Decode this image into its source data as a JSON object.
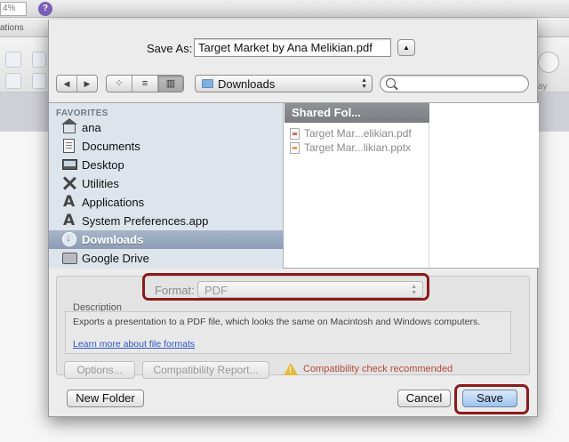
{
  "background_app": {
    "zoom_value": "4%",
    "help_symbol": "?",
    "tab_label": "ations",
    "right_label": "ay"
  },
  "dialog": {
    "save_as_label": "Save As:",
    "filename": "Target Market by Ana Melikian.pdf",
    "expand_symbol": "▲",
    "nav": {
      "back_symbol": "◀",
      "forward_symbol": "▶"
    },
    "view_modes": [
      "⁘",
      "≡",
      "▥"
    ],
    "location": "Downloads",
    "search_placeholder": "",
    "sidebar": {
      "header": "FAVORITES",
      "items": [
        {
          "label": "ana",
          "icon": "home-icon"
        },
        {
          "label": "Documents",
          "icon": "documents-icon"
        },
        {
          "label": "Desktop",
          "icon": "desktop-icon"
        },
        {
          "label": "Utilities",
          "icon": "utilities-icon"
        },
        {
          "label": "Applications",
          "icon": "applications-icon"
        },
        {
          "label": "System Preferences.app",
          "icon": "system-preferences-icon"
        },
        {
          "label": "Downloads",
          "icon": "downloads-icon",
          "selected": true
        },
        {
          "label": "Google Drive",
          "icon": "folder-icon"
        }
      ]
    },
    "column1": {
      "header": "Shared Fol...",
      "files": [
        {
          "name": "Target Mar...elikian.pdf",
          "icon": "pdf-file-icon"
        },
        {
          "name": "Target Mar...likian.pptx",
          "icon": "pptx-file-icon"
        }
      ]
    },
    "options": {
      "format_label": "Format:",
      "format_value": "PDF",
      "description_label": "Description",
      "description_text": "Exports a presentation to a PDF file, which looks the same on Macintosh and Windows computers.",
      "learn_more_link": "Learn more about file formats",
      "options_button": "Options...",
      "compat_button": "Compatibility Report...",
      "compat_warning": "Compatibility check recommended"
    },
    "buttons": {
      "new_folder": "New Folder",
      "cancel": "Cancel",
      "save": "Save"
    }
  },
  "colors": {
    "highlight": "#8b1a1a",
    "sidebar_bg": "#dde4ec",
    "selected_row": "#8e9db6",
    "warning_text": "#b24a3a",
    "link": "#2c56c8"
  }
}
